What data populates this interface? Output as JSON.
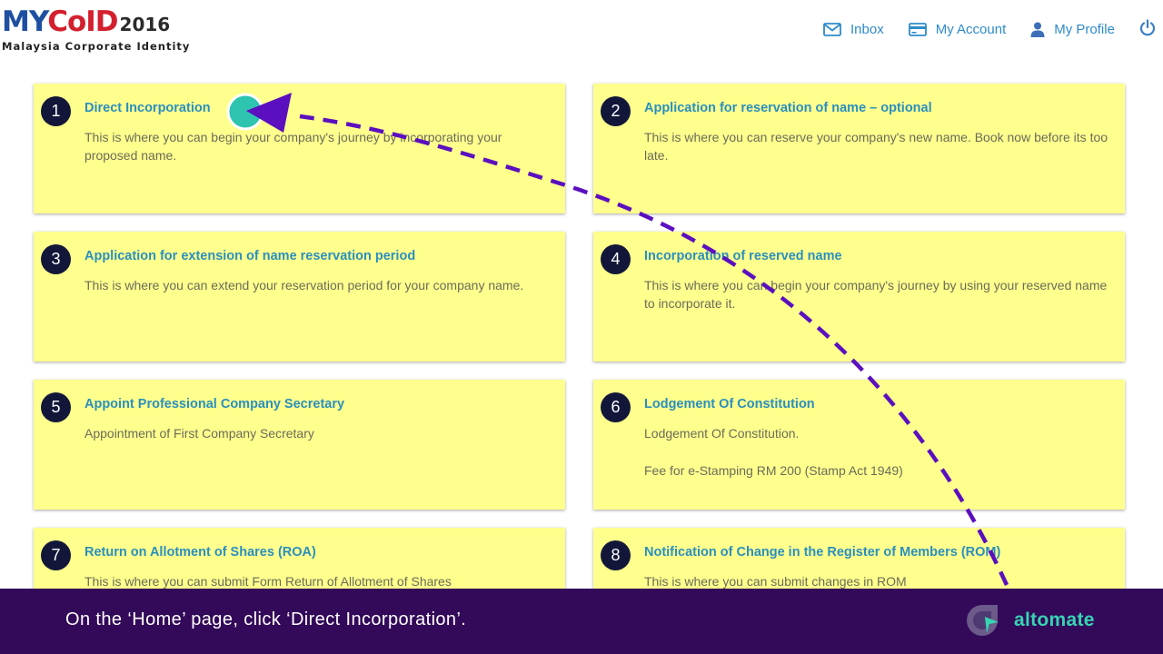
{
  "header": {
    "logo": {
      "brand_my": "MY",
      "brand_coid": "CoID",
      "year": "2016",
      "subtitle": "Malaysia Corporate Identity"
    },
    "nav": {
      "inbox": "Inbox",
      "my_account": "My Account",
      "my_profile": "My Profile"
    }
  },
  "cards": [
    {
      "number": "1",
      "title": "Direct Incorporation",
      "description": "This is where you can begin your company's journey by incorporating your proposed name."
    },
    {
      "number": "2",
      "title": "Application for reservation of name – optional",
      "description": "This is where you can reserve your company's new name. Book now before its too late."
    },
    {
      "number": "3",
      "title": "Application for extension of name reservation period",
      "description": "This is where you can extend your reservation period for your company name."
    },
    {
      "number": "4",
      "title": "Incorporation of reserved name",
      "description": "This is where you can begin your company's journey by using your reserved name to incorporate it."
    },
    {
      "number": "5",
      "title": "Appoint Professional Company Secretary",
      "description": "Appointment of First Company Secretary"
    },
    {
      "number": "6",
      "title": "Lodgement Of Constitution",
      "description": "Lodgement Of Constitution.",
      "description2": "Fee for e-Stamping RM 200 (Stamp Act 1949)"
    },
    {
      "number": "7",
      "title": "Return on Allotment of Shares (ROA)",
      "description": "This is where you can submit Form Return of Allotment of Shares"
    },
    {
      "number": "8",
      "title": "Notification of Change in the Register of Members (ROM)",
      "description": "This is where you can submit changes in ROM"
    }
  ],
  "banner": {
    "instruction": "On the ‘Home’ page, click ‘Direct Incorporation’.",
    "brand_name": "altomate"
  },
  "colors": {
    "card_bg": "#ffff8d",
    "title_color": "#2a8fbe",
    "badge_bg": "#12173a",
    "banner_bg": "#33095a",
    "arrow_color": "#5b0fbf",
    "click_marker": "#2ec4b0",
    "brand_color": "#37d4b2"
  },
  "icons": {
    "inbox": "envelope-icon",
    "my_account": "credit-card-icon",
    "my_profile": "user-icon",
    "logout": "power-icon"
  }
}
